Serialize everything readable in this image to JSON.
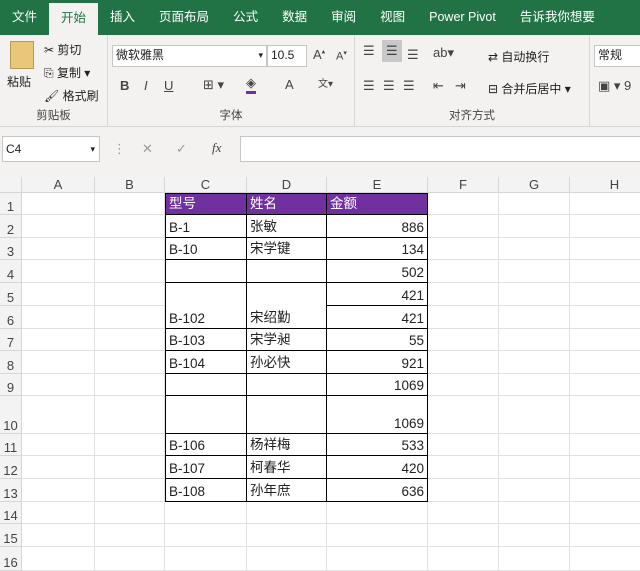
{
  "tabs": [
    "文件",
    "开始",
    "插入",
    "页面布局",
    "公式",
    "数据",
    "审阅",
    "视图",
    "Power Pivot",
    "告诉我你想要"
  ],
  "ribbon": {
    "paste": "粘贴",
    "cut": "剪切",
    "copy": "复制",
    "format_painter": "格式刷",
    "clipboard": "剪贴板",
    "font_name": "微软雅黑",
    "font_size": "10.5",
    "font_group": "字体",
    "wrap": "自动换行",
    "merge": "合并后居中",
    "align_group": "对齐方式",
    "number_format": "常规",
    "bold": "B",
    "italic": "I",
    "underline": "U",
    "font_color": "A"
  },
  "formula": {
    "name_box": "C4",
    "fx": "fx",
    "value": ""
  },
  "columns": [
    "A",
    "B",
    "C",
    "D",
    "E",
    "F",
    "G",
    "H"
  ],
  "rows": [
    "1",
    "2",
    "3",
    "4",
    "5",
    "6",
    "7",
    "8",
    "9",
    "10",
    "11",
    "12",
    "13",
    "14",
    "15",
    "16"
  ],
  "table": {
    "headers": [
      "型号",
      "姓名",
      "金额"
    ],
    "rows": [
      [
        "B-1",
        "张敏",
        "886"
      ],
      [
        "B-10",
        "宋学键",
        "134"
      ],
      [
        "",
        "",
        "502"
      ],
      [
        "B-102",
        "宋绍勤",
        "421"
      ],
      [
        "",
        "",
        "421"
      ],
      [
        "B-103",
        "宋学昶",
        "55"
      ],
      [
        "B-104",
        "孙必快",
        "921"
      ],
      [
        "",
        "",
        "1069"
      ],
      [
        "",
        "",
        "1069"
      ],
      [
        "B-106",
        "杨祥梅",
        "533"
      ],
      [
        "B-107",
        "柯春华",
        "420"
      ],
      [
        "B-108",
        "孙年庶",
        "636"
      ]
    ]
  },
  "colors": {
    "header_fill": "#7030a0",
    "excel_green": "#217346"
  }
}
